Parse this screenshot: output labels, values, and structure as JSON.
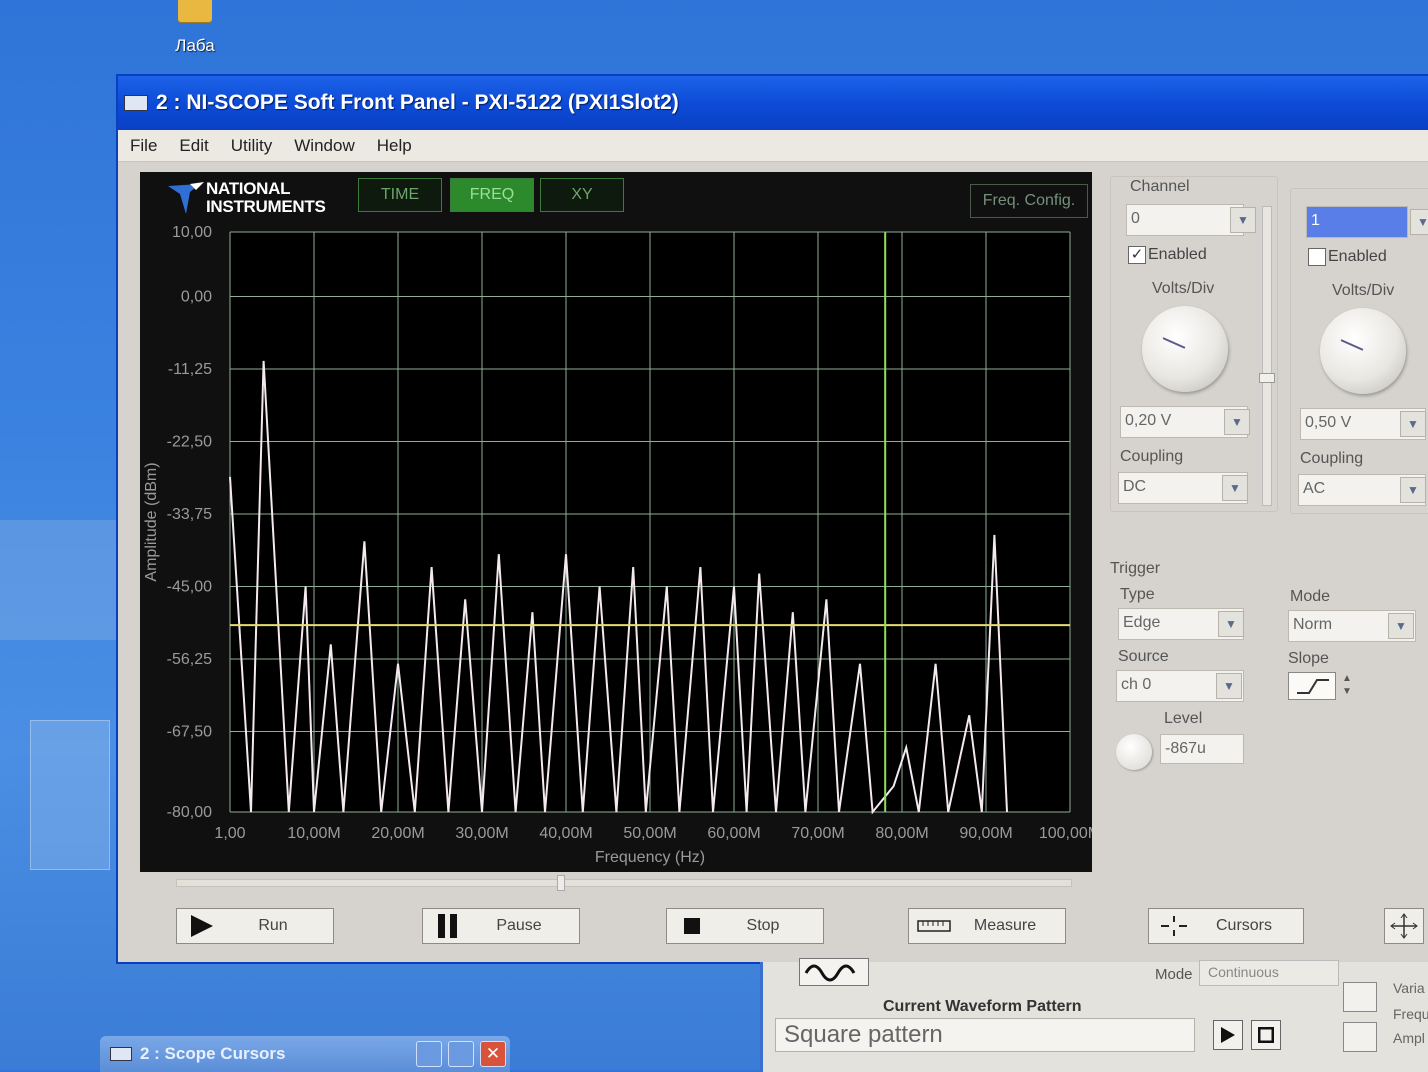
{
  "desktop": {
    "folder_label": "Лаба"
  },
  "window": {
    "title": "2 : NI-SCOPE Soft Front Panel - PXI-5122 (PXI1Slot2)",
    "menu": [
      "File",
      "Edit",
      "Utility",
      "Window",
      "Help"
    ]
  },
  "graph": {
    "logo_line1": "NATIONAL",
    "logo_line2": "INSTRUMENTS",
    "tabs": [
      "TIME",
      "FREQ",
      "XY"
    ],
    "active_tab": "FREQ",
    "config_button": "Freq. Config.",
    "y_axis_label": "Amplitude (dBm)",
    "x_axis_label": "Frequency (Hz)",
    "y_ticks": [
      "10,00",
      "0,00",
      "-11,25",
      "-22,50",
      "-33,75",
      "-45,00",
      "-56,25",
      "-67,50",
      "-80,00"
    ],
    "x_ticks": [
      "1,00",
      "10,00M",
      "20,00M",
      "30,00M",
      "40,00M",
      "50,00M",
      "60,00M",
      "70,00M",
      "80,00M",
      "90,00M",
      "100,00M"
    ],
    "colors": {
      "plot_bg": "#000000",
      "grid": "#8fae95",
      "trace": "#f3e9ee",
      "cursor_h": "#e6dc70",
      "cursor_v": "#8ee05c"
    }
  },
  "channel0": {
    "section_label": "Channel",
    "value": "0",
    "enabled_label": "Enabled",
    "enabled": true,
    "volts_div_label": "Volts/Div",
    "volts_div": "0,20 V",
    "coupling_label": "Coupling",
    "coupling": "DC"
  },
  "channel1": {
    "value": "1",
    "enabled_label": "Enabled",
    "enabled": false,
    "volts_div_label": "Volts/Div",
    "volts_div": "0,50 V",
    "coupling_label": "Coupling",
    "coupling": "AC"
  },
  "trigger": {
    "section_label": "Trigger",
    "type_label": "Type",
    "type": "Edge",
    "mode_label": "Mode",
    "mode": "Norm",
    "source_label": "Source",
    "source": "ch 0",
    "slope_label": "Slope",
    "level_label": "Level",
    "level": "-867u"
  },
  "buttons": {
    "run": "Run",
    "pause": "Pause",
    "stop": "Stop",
    "measure": "Measure",
    "cursors": "Cursors"
  },
  "lower_window": {
    "mode_label": "Mode",
    "mode_value": "Continuous",
    "pattern_title": "Current Waveform Pattern",
    "pattern_value": "Square pattern",
    "side_labels": [
      "Varia",
      "Frequ",
      "Ampl"
    ]
  },
  "taskbar": {
    "cursor_window": "2 : Scope Cursors"
  },
  "chart_data": {
    "type": "line",
    "x_unit": "Hz",
    "xlim": [
      1,
      100000000
    ],
    "ylim": [
      -80,
      10
    ],
    "xlabel": "Frequency (Hz)",
    "ylabel": "Amplitude (dBm)",
    "grid": true,
    "peaks": [
      [
        1,
        -28
      ],
      [
        2500000,
        -80
      ],
      [
        4000000,
        -10
      ],
      [
        7000000,
        -80
      ],
      [
        9000000,
        -45
      ],
      [
        10000000,
        -80
      ],
      [
        12000000,
        -54
      ],
      [
        13500000,
        -80
      ],
      [
        16000000,
        -38
      ],
      [
        18000000,
        -80
      ],
      [
        20000000,
        -57
      ],
      [
        22000000,
        -80
      ],
      [
        24000000,
        -42
      ],
      [
        26000000,
        -80
      ],
      [
        28000000,
        -47
      ],
      [
        30000000,
        -80
      ],
      [
        32000000,
        -40
      ],
      [
        34000000,
        -80
      ],
      [
        36000000,
        -49
      ],
      [
        37500000,
        -80
      ],
      [
        40000000,
        -40
      ],
      [
        42000000,
        -80
      ],
      [
        44000000,
        -45
      ],
      [
        46000000,
        -80
      ],
      [
        48000000,
        -42
      ],
      [
        49500000,
        -80
      ],
      [
        52000000,
        -45
      ],
      [
        53500000,
        -80
      ],
      [
        56000000,
        -42
      ],
      [
        57500000,
        -80
      ],
      [
        60000000,
        -45
      ],
      [
        61500000,
        -80
      ],
      [
        63000000,
        -43
      ],
      [
        65000000,
        -80
      ],
      [
        67000000,
        -49
      ],
      [
        68500000,
        -80
      ],
      [
        71000000,
        -47
      ],
      [
        72500000,
        -80
      ],
      [
        75000000,
        -57
      ],
      [
        76500000,
        -80
      ],
      [
        79000000,
        -76
      ],
      [
        80500000,
        -70
      ],
      [
        82000000,
        -80
      ],
      [
        84000000,
        -57
      ],
      [
        85500000,
        -80
      ],
      [
        88000000,
        -65
      ],
      [
        89500000,
        -80
      ],
      [
        91000000,
        -37
      ],
      [
        92500000,
        -80
      ]
    ]
  }
}
